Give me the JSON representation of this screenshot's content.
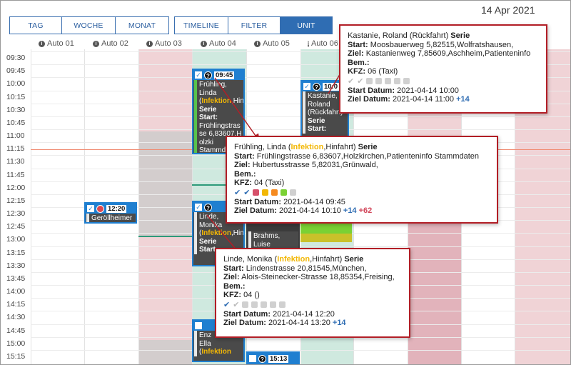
{
  "date": "14 Apr 2021",
  "view_buttons": [
    "TAG",
    "WOCHE",
    "MONAT"
  ],
  "mode_buttons": [
    "TIMELINE",
    "FILTER",
    "UNIT"
  ],
  "active_mode": "UNIT",
  "columns": [
    "Auto 01",
    "Auto 02",
    "Auto 03",
    "Auto 04",
    "Auto 05",
    "Auto 06"
  ],
  "times": [
    "09:30",
    "09:45",
    "10:00",
    "10:15",
    "10:30",
    "10:45",
    "11:00",
    "11:15",
    "11:30",
    "11:45",
    "12:00",
    "12:15",
    "12:30",
    "12:45",
    "13:00",
    "13:15",
    "13:30",
    "13:45",
    "14:00",
    "14:15",
    "14:30",
    "14:45",
    "15:00",
    "15:15"
  ],
  "events": {
    "e1": {
      "time": "09:45",
      "name": "Frühling, Linda",
      "infektion": "Infektion",
      "rest": ",Hin",
      "serie": "Serie",
      "start_label": "Start:",
      "start": "Frühlingstrasse 6,83607,Holzki",
      "stamm": "Stammd...",
      "tail": "Ziel..."
    },
    "e2": {
      "time": "10:0",
      "name1": "Kastanie,",
      "name2": "Roland",
      "name3": "(Rückfahrt)",
      "serie": "Serie",
      "start_label": "Start:",
      "start": "Moosba..."
    },
    "e3": {
      "time": "12:20",
      "name": "Geröllheimer"
    },
    "e4": {
      "name1": "Linde,",
      "name2": "Monika",
      "infektion": "Infektion",
      "rest": ",Hinf",
      "serie": "Serie",
      "start_label": "Start",
      "tail": "Linde"
    },
    "e5": {
      "name1": "Brahms,",
      "name2": "Luise"
    },
    "e6": {
      "name1": "Enz",
      "name2": "Ella",
      "infektion": "Infektion"
    },
    "e7": {
      "time": "15:13"
    }
  },
  "popups": {
    "kastanie": {
      "title": "Kastanie, Roland (Rückfahrt)",
      "serie": "Serie",
      "start_label": "Start:",
      "start": "Moosbauerweg 5,82515,Wolfratshausen,",
      "ziel_label": "Ziel:",
      "ziel": "Kastanienweg 7,85609,Aschheim,Patienteninfo",
      "bem_label": "Bem.:",
      "kfz_label": "KFZ:",
      "kfz": "06 (Taxi)",
      "sd_label": "Start Datum:",
      "sd": "2021-04-14 10:00",
      "zd_label": "Ziel Datum:",
      "zd": "2021-04-14 11:00",
      "zd_plus": "+14"
    },
    "fruehling": {
      "title_pre": "Frühling, Linda (",
      "infektion": "Infektion",
      "title_post": ",Hinfahrt)",
      "serie": "Serie",
      "start_label": "Start:",
      "start": "Frühlingstrasse 6,83607,Holzkirchen,Patienteninfo Stammdaten",
      "ziel_label": "Ziel:",
      "ziel": "Hubertusstrasse 5,82031,Grünwald,",
      "bem_label": "Bem.:",
      "kfz_label": "KFZ:",
      "kfz": "04 (Taxi)",
      "sd_label": "Start Datum:",
      "sd": "2021-04-14 09:45",
      "zd_label": "Ziel Datum:",
      "zd": "2021-04-14 10:10",
      "zd_plus": "+14",
      "zd_minus": "+62",
      "status_colors": [
        "#d6506a",
        "#f2b705",
        "#f58a1f",
        "#7ad134",
        "#d0d0d0"
      ]
    },
    "linde": {
      "title_pre": "Linde, Monika (",
      "infektion": "Infektion",
      "title_post": ",Hinfahrt)",
      "serie": "Serie",
      "start_label": "Start:",
      "start": "Lindenstrasse 20,81545,München,",
      "ziel_label": "Ziel:",
      "ziel": "Alois-Steinecker-Strasse 18,85354,Freising,",
      "bem_label": "Bem.:",
      "kfz_label": "KFZ:",
      "kfz": "04 ()",
      "sd_label": "Start Datum:",
      "sd": "2021-04-14 12:20",
      "zd_label": "Ziel Datum:",
      "zd": "2021-04-14 13:20",
      "zd_plus": "+14"
    }
  },
  "colors": {
    "accent": "#2f6db3",
    "unavailable_pink": "#f0d3d6",
    "unavailable_gray": "#d3cdcd",
    "active_teal": "#cfe9df",
    "popup_border": "#b21e26",
    "now_line": "#f08a70"
  }
}
